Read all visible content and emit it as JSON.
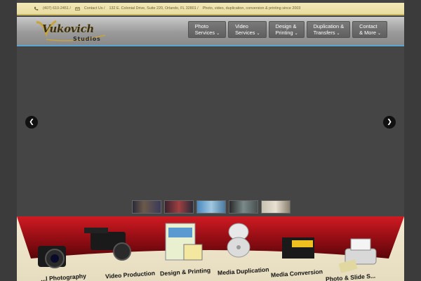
{
  "topbar": {
    "phone": "(407) 610-2451 /",
    "contact": "Contact Us /",
    "address": "132 E. Colonial Drive, Suite 220, Orlando, FL 32801 /",
    "tagline": "Photo, video, duplication, conversion & printing since 2003"
  },
  "logo": {
    "main": "Vukovich",
    "sub": "Studios"
  },
  "nav": [
    {
      "line1": "Photo",
      "line2": "Services"
    },
    {
      "line1": "Video",
      "line2": "Services"
    },
    {
      "line1": "Design &",
      "line2": "Printing"
    },
    {
      "line1": "Duplication &",
      "line2": "Transfers"
    },
    {
      "line1": "Contact",
      "line2": "& More"
    }
  ],
  "slider": {
    "prev_glyph": "❮",
    "next_glyph": "❯",
    "thumbnail_count": 5
  },
  "services": [
    "...l Photography",
    "Video Production",
    "Design & Printing",
    "Media Duplication",
    "Media Conversion",
    "Photo & Slide S..."
  ],
  "colors": {
    "accent_blue": "#5aa7d6",
    "banner_red": "#b0121a",
    "topbar_bg": "#f3e9b8"
  }
}
